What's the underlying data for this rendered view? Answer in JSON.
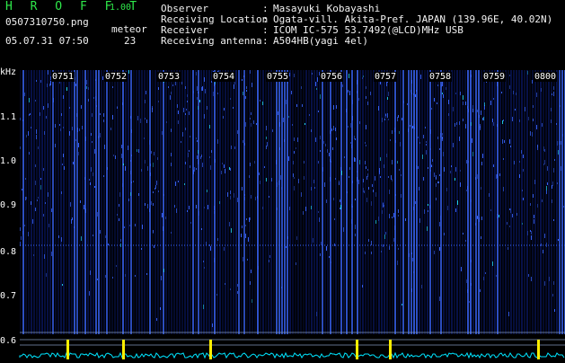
{
  "app": {
    "title": "H R O F F T",
    "version": "1.00"
  },
  "file": {
    "name": "0507310750.png",
    "datetime": "05.07.31 07:50"
  },
  "meteor": {
    "label": "meteor",
    "count": "23"
  },
  "info": [
    {
      "label": "Observer",
      "value": "Masayuki Kobayashi"
    },
    {
      "label": "Receiving Location",
      "value": "Ogata-vill. Akita-Pref. JAPAN (139.96E, 40.02N)"
    },
    {
      "label": "Receiver",
      "value": "ICOM IC-575 53.7492(@LCD)MHz USB"
    },
    {
      "label": "Receiving antenna",
      "value": "A504HB(yagi 4el)"
    }
  ],
  "axis": {
    "unit": "kHz",
    "ticks": [
      "1.1",
      "1.0",
      "0.9",
      "0.8",
      "0.7",
      "0.6"
    ]
  },
  "time_marks": [
    "0751",
    "0752",
    "0753",
    "0754",
    "0755",
    "0756",
    "0757",
    "0758",
    "0759",
    "0800"
  ],
  "colors": {
    "background": "#000000",
    "spectrogram_base": "#0a1a6e",
    "signal": "#3a66ff",
    "highlight": "#22d6e8",
    "header_green": "#2ee84a",
    "trace": "#00e5ff",
    "spike": "#ffee00"
  }
}
